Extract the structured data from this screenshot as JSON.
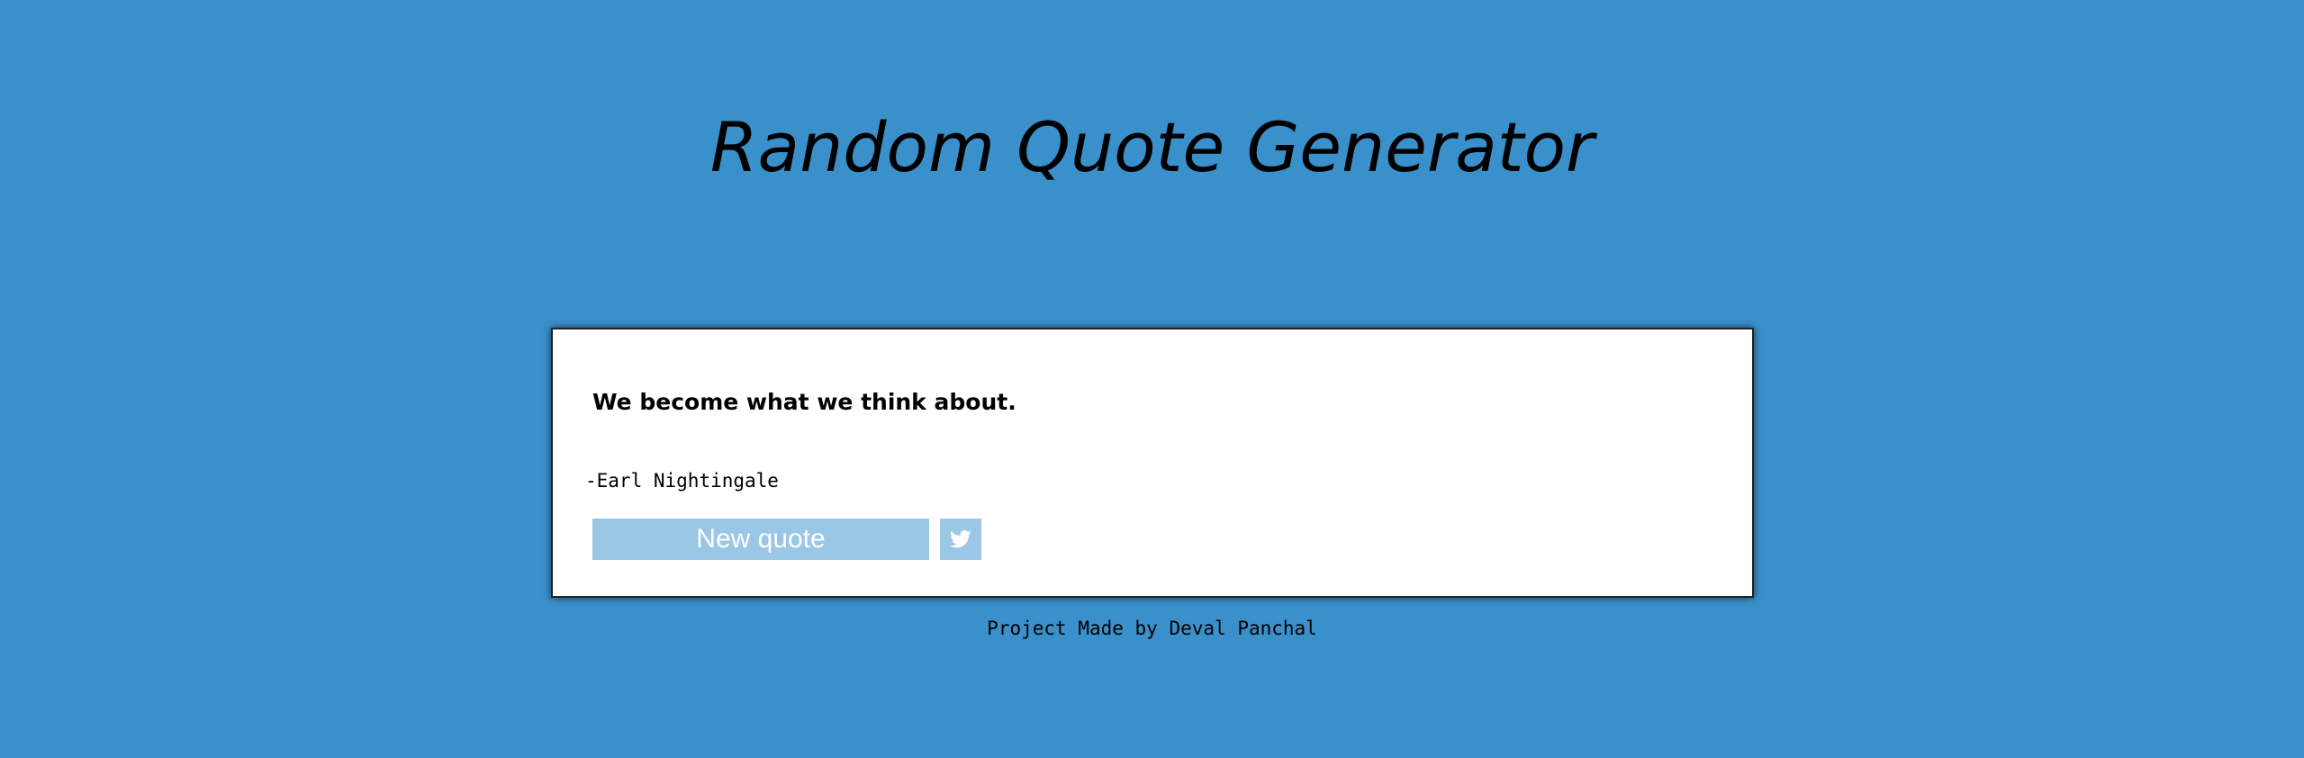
{
  "header": {
    "title": "Random Quote Generator"
  },
  "quote_card": {
    "quote": "We become what we think about.",
    "author": "-Earl Nightingale",
    "new_quote_label": "New quote",
    "tweet_icon": "twitter-icon"
  },
  "footer": {
    "credit": "Project Made by Deval Panchal"
  },
  "colors": {
    "background": "#3a90cb",
    "card": "#ffffff",
    "button": "#9ac7e5",
    "button_text": "#ffffff"
  }
}
